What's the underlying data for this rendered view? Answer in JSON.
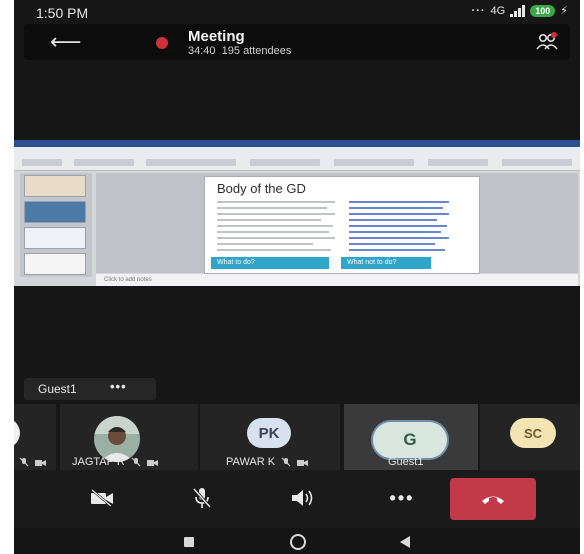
{
  "status_bar": {
    "time": "1:50 PM",
    "network": "4G",
    "battery": "100"
  },
  "header": {
    "title": "Meeting",
    "duration": "34:40",
    "attendees": "195 attendees",
    "icons": [
      "back-arrow-icon",
      "recording-dot-icon",
      "people-icon"
    ]
  },
  "shared_screen": {
    "slide_title": "Body of the GD",
    "left_button": "What to do?",
    "right_button": "What not to do?",
    "notes_placeholder": "Click to add notes"
  },
  "speaker_chip": {
    "name": "Guest1",
    "more": "•••"
  },
  "participants": [
    {
      "name": "",
      "initials": "",
      "type": "partial"
    },
    {
      "name": "JAGTAP R",
      "initials": "",
      "type": "photo"
    },
    {
      "name": "PAWAR K",
      "initials": "PK",
      "type": "initials"
    },
    {
      "name": "Guest1",
      "initials": "G",
      "type": "initials",
      "active": true
    },
    {
      "name": "",
      "initials": "SC",
      "type": "initials"
    }
  ],
  "controls": {
    "camera": "camera-off-icon",
    "mic": "mic-off-icon",
    "speaker": "speaker-icon",
    "more": "•••",
    "hangup": "hang-up-icon"
  },
  "colors": {
    "background": "#161616",
    "hangup": "#c23a4a",
    "recording": "#d0303a",
    "battery": "#3ba84a",
    "slide_button": "#2ea5c9"
  }
}
